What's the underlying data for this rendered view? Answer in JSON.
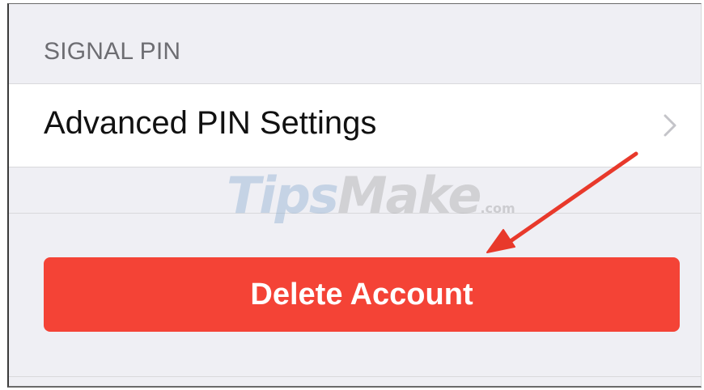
{
  "settings": {
    "section_header": "SIGNAL PIN",
    "advanced_pin_row": {
      "label": "Advanced PIN Settings",
      "icon": "chevron-right-icon"
    },
    "delete_button": {
      "label": "Delete Account",
      "color": "#f44336"
    }
  },
  "watermark": {
    "text_a": "Tips",
    "text_b": "Make",
    "suffix": ".com"
  },
  "annotation": {
    "icon": "red-arrow-icon",
    "color": "#e8392b"
  },
  "colors": {
    "background": "#efeff4",
    "header_text": "#6d6d72",
    "row_background": "#ffffff"
  }
}
